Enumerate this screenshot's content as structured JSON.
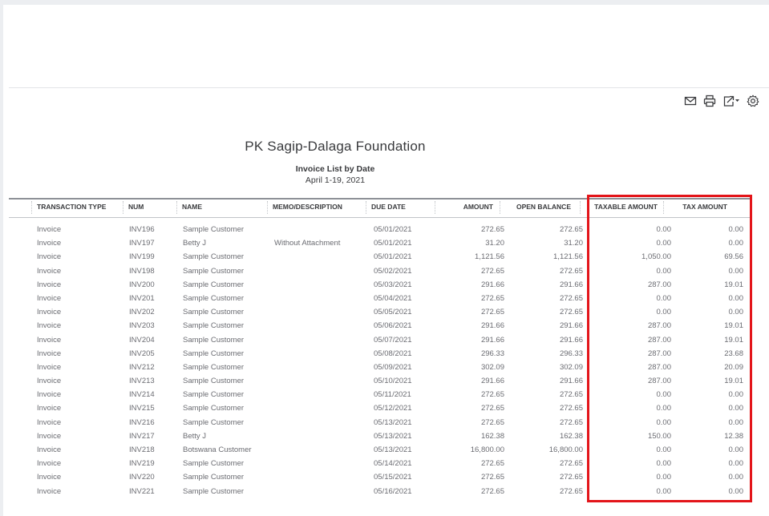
{
  "report": {
    "company": "PK Sagip-Dalaga Foundation",
    "title": "Invoice List by Date",
    "date_range": "April 1-19, 2021"
  },
  "toolbar": {
    "icons": [
      "email-icon",
      "print-icon",
      "export-icon",
      "settings-icon"
    ]
  },
  "columns": {
    "transaction_type": "TRANSACTION TYPE",
    "num": "NUM",
    "name": "NAME",
    "memo": "MEMO/DESCRIPTION",
    "due_date": "DUE DATE",
    "amount": "AMOUNT",
    "open_balance": "OPEN BALANCE",
    "taxable_amount": "TAXABLE AMOUNT",
    "tax_amount": "TAX AMOUNT"
  },
  "rows": [
    {
      "type": "Invoice",
      "num": "INV196",
      "name": "Sample Customer",
      "memo": "",
      "due": "05/01/2021",
      "amount": "272.65",
      "open": "272.65",
      "taxable": "0.00",
      "tax": "0.00"
    },
    {
      "type": "Invoice",
      "num": "INV197",
      "name": "Betty J",
      "memo": "Without Attachment",
      "due": "05/01/2021",
      "amount": "31.20",
      "open": "31.20",
      "taxable": "0.00",
      "tax": "0.00"
    },
    {
      "type": "Invoice",
      "num": "INV199",
      "name": "Sample Customer",
      "memo": "",
      "due": "05/01/2021",
      "amount": "1,121.56",
      "open": "1,121.56",
      "taxable": "1,050.00",
      "tax": "69.56"
    },
    {
      "type": "Invoice",
      "num": "INV198",
      "name": "Sample Customer",
      "memo": "",
      "due": "05/02/2021",
      "amount": "272.65",
      "open": "272.65",
      "taxable": "0.00",
      "tax": "0.00"
    },
    {
      "type": "Invoice",
      "num": "INV200",
      "name": "Sample Customer",
      "memo": "",
      "due": "05/03/2021",
      "amount": "291.66",
      "open": "291.66",
      "taxable": "287.00",
      "tax": "19.01"
    },
    {
      "type": "Invoice",
      "num": "INV201",
      "name": "Sample Customer",
      "memo": "",
      "due": "05/04/2021",
      "amount": "272.65",
      "open": "272.65",
      "taxable": "0.00",
      "tax": "0.00"
    },
    {
      "type": "Invoice",
      "num": "INV202",
      "name": "Sample Customer",
      "memo": "",
      "due": "05/05/2021",
      "amount": "272.65",
      "open": "272.65",
      "taxable": "0.00",
      "tax": "0.00"
    },
    {
      "type": "Invoice",
      "num": "INV203",
      "name": "Sample Customer",
      "memo": "",
      "due": "05/06/2021",
      "amount": "291.66",
      "open": "291.66",
      "taxable": "287.00",
      "tax": "19.01"
    },
    {
      "type": "Invoice",
      "num": "INV204",
      "name": "Sample Customer",
      "memo": "",
      "due": "05/07/2021",
      "amount": "291.66",
      "open": "291.66",
      "taxable": "287.00",
      "tax": "19.01"
    },
    {
      "type": "Invoice",
      "num": "INV205",
      "name": "Sample Customer",
      "memo": "",
      "due": "05/08/2021",
      "amount": "296.33",
      "open": "296.33",
      "taxable": "287.00",
      "tax": "23.68"
    },
    {
      "type": "Invoice",
      "num": "INV212",
      "name": "Sample Customer",
      "memo": "",
      "due": "05/09/2021",
      "amount": "302.09",
      "open": "302.09",
      "taxable": "287.00",
      "tax": "20.09"
    },
    {
      "type": "Invoice",
      "num": "INV213",
      "name": "Sample Customer",
      "memo": "",
      "due": "05/10/2021",
      "amount": "291.66",
      "open": "291.66",
      "taxable": "287.00",
      "tax": "19.01"
    },
    {
      "type": "Invoice",
      "num": "INV214",
      "name": "Sample Customer",
      "memo": "",
      "due": "05/11/2021",
      "amount": "272.65",
      "open": "272.65",
      "taxable": "0.00",
      "tax": "0.00"
    },
    {
      "type": "Invoice",
      "num": "INV215",
      "name": "Sample Customer",
      "memo": "",
      "due": "05/12/2021",
      "amount": "272.65",
      "open": "272.65",
      "taxable": "0.00",
      "tax": "0.00"
    },
    {
      "type": "Invoice",
      "num": "INV216",
      "name": "Sample Customer",
      "memo": "",
      "due": "05/13/2021",
      "amount": "272.65",
      "open": "272.65",
      "taxable": "0.00",
      "tax": "0.00"
    },
    {
      "type": "Invoice",
      "num": "INV217",
      "name": "Betty J",
      "memo": "",
      "due": "05/13/2021",
      "amount": "162.38",
      "open": "162.38",
      "taxable": "150.00",
      "tax": "12.38"
    },
    {
      "type": "Invoice",
      "num": "INV218",
      "name": "Botswana Customer",
      "memo": "",
      "due": "05/13/2021",
      "amount": "16,800.00",
      "open": "16,800.00",
      "taxable": "0.00",
      "tax": "0.00"
    },
    {
      "type": "Invoice",
      "num": "INV219",
      "name": "Sample Customer",
      "memo": "",
      "due": "05/14/2021",
      "amount": "272.65",
      "open": "272.65",
      "taxable": "0.00",
      "tax": "0.00"
    },
    {
      "type": "Invoice",
      "num": "INV220",
      "name": "Sample Customer",
      "memo": "",
      "due": "05/15/2021",
      "amount": "272.65",
      "open": "272.65",
      "taxable": "0.00",
      "tax": "0.00"
    },
    {
      "type": "Invoice",
      "num": "INV221",
      "name": "Sample Customer",
      "memo": "",
      "due": "05/16/2021",
      "amount": "272.65",
      "open": "272.65",
      "taxable": "0.00",
      "tax": "0.00"
    }
  ],
  "colors": {
    "highlight": "#e3151a",
    "text": "#393a3d",
    "muted_text": "#6b6c72",
    "header_rule": "#8d9096"
  }
}
